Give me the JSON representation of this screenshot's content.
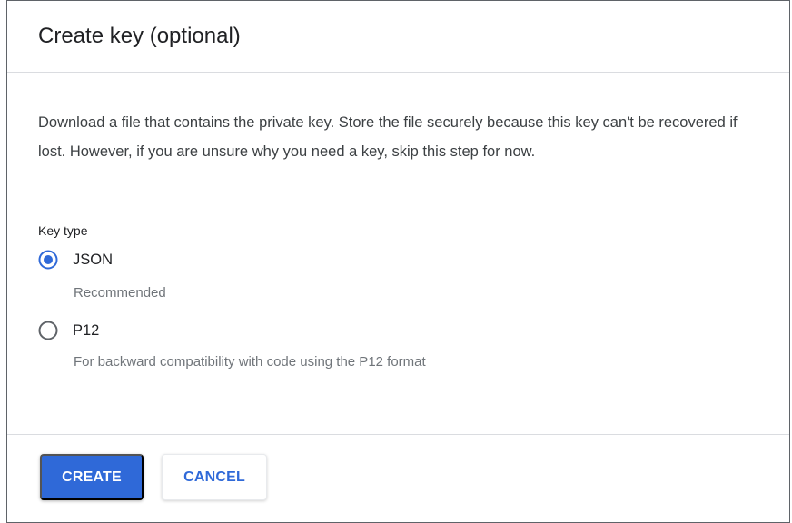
{
  "dialog": {
    "title": "Create key (optional)",
    "description": "Download a file that contains the private key. Store the file securely because this key can't be recovered if lost. However, if you are unsure why you need a key, skip this step for now."
  },
  "key_type": {
    "label": "Key type",
    "selected": "JSON",
    "options": [
      {
        "label": "JSON",
        "hint": "Recommended",
        "checked": true,
        "icon": "radio-checked-icon"
      },
      {
        "label": "P12",
        "hint": "For backward compatibility with code using the P12 format",
        "checked": false,
        "icon": "radio-unchecked-icon"
      }
    ]
  },
  "actions": {
    "create_label": "CREATE",
    "cancel_label": "CANCEL"
  },
  "colors": {
    "accent": "#2f69d8",
    "radio_unchecked": "#5f6368",
    "divider": "#dadce0"
  }
}
